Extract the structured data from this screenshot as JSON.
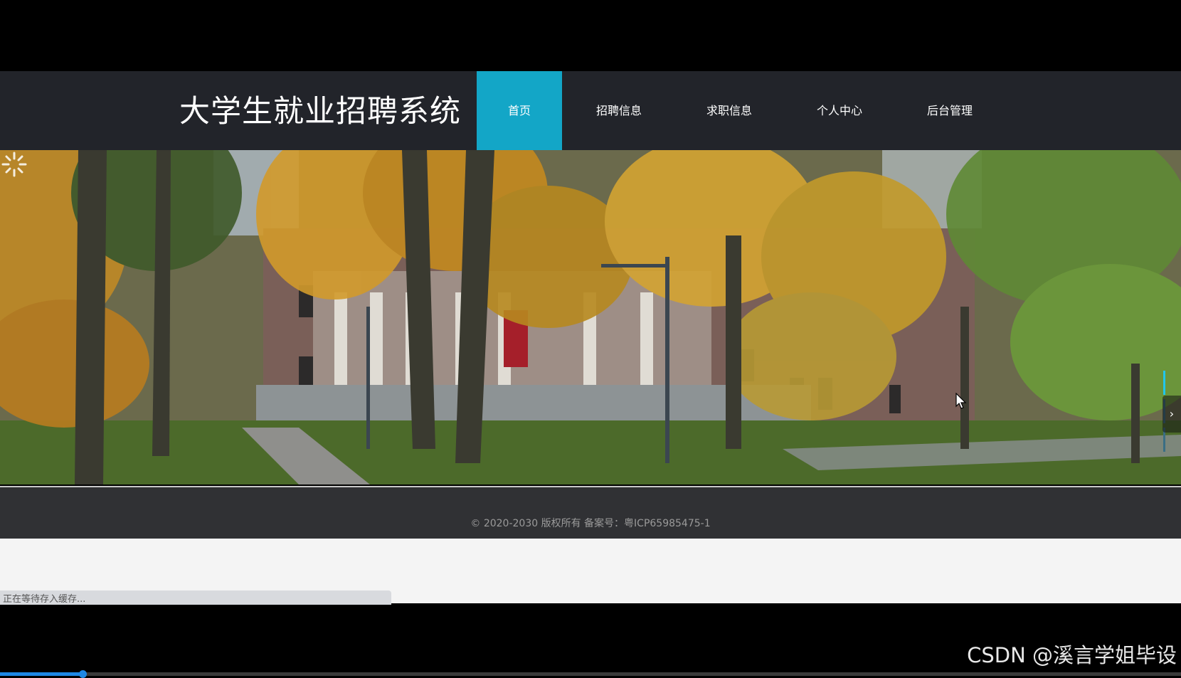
{
  "header": {
    "site_title": "大学生就业招聘系统",
    "nav": [
      {
        "label": "首页",
        "active": true
      },
      {
        "label": "招聘信息",
        "active": false
      },
      {
        "label": "求职信息",
        "active": false
      },
      {
        "label": "个人中心",
        "active": false
      },
      {
        "label": "后台管理",
        "active": false
      }
    ]
  },
  "banner": {
    "indicator_count": 3,
    "active_indicator": 1,
    "next_icon": "chevron-right-icon",
    "next_glyph": "›"
  },
  "footer": {
    "copyright": "© 2020-2030 版权所有 备案号：粤ICP65985475-1"
  },
  "status": {
    "cache_message": "正在等待存入缓存..."
  },
  "watermark": "CSDN @溪言学姐毕设",
  "video": {
    "progress": 0.07
  },
  "colors": {
    "header_bg": "#22242a",
    "nav_active_bg": "#13a6c7",
    "footer_bg": "#303134"
  }
}
